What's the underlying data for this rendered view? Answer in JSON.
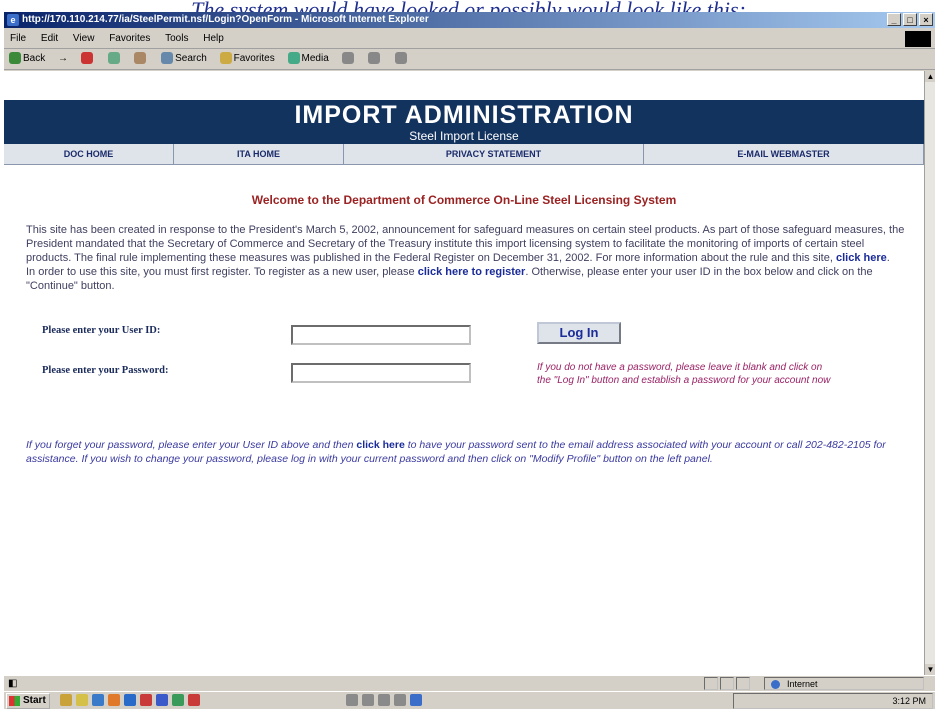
{
  "caption": "The system would have looked or possibly would look like this:",
  "window": {
    "title": "http://170.110.214.77/ia/SteelPermit.nsf/Login?OpenForm - Microsoft Internet Explorer",
    "controls": [
      "_",
      "□",
      "×"
    ]
  },
  "menubar": [
    "File",
    "Edit",
    "View",
    "Favorites",
    "Tools",
    "Help"
  ],
  "toolbar": {
    "back": "Back",
    "search": "Search",
    "favorites": "Favorites",
    "media": "Media"
  },
  "page": {
    "banner_title": "IMPORT ADMINISTRATION",
    "banner_subtitle": "Steel Import License",
    "nav": [
      "DOC HOME",
      "ITA HOME",
      "PRIVACY STATEMENT",
      "E-MAIL WEBMASTER"
    ],
    "welcome": "Welcome to the Department of Commerce On-Line Steel Licensing System",
    "intro_text": "This site has been created in response to the President's March 5, 2002, announcement for safeguard measures on certain steel products. As part of those safeguard measures, the President mandated that the Secretary of Commerce and Secretary of the Treasury institute this import licensing system to facilitate the monitoring of imports of certain steel products. The final rule implementing these measures was published in the Federal Register on December 31, 2002. For more information about the rule and this site,",
    "intro_link": "click here",
    "register_text_1": "In order to use this site, you must first register. To register as a new user, please",
    "register_link": "click here to register",
    "register_text_2": ". Otherwise, please enter your user ID in the box below and click on the \"Continue\" button.",
    "user_label": "Please enter your User ID:",
    "password_label": "Please enter your Password:",
    "user_value": "",
    "password_value": "",
    "login_button": "Log In",
    "password_note": "If you do not have a password, please leave it blank and click on the \"Log In\" button and establish a password for your account now",
    "forgot_text_1": "If you forget your password, please enter your User ID above and then",
    "forgot_link": "click here",
    "forgot_text_2": "to have your password sent to the email address associated with your account or call 202-482-2105 for assistance. If you wish to change your password, please log in with your current password and then click on \"Modify Profile\" button on the left panel."
  },
  "status": {
    "zone": "Internet"
  },
  "taskbar": {
    "start": "Start",
    "clock": "3:12 PM"
  },
  "colors": {
    "banner": "#13335f",
    "welcome": "#9a2222",
    "note": "#9a2266",
    "link": "#1a2b9a"
  }
}
